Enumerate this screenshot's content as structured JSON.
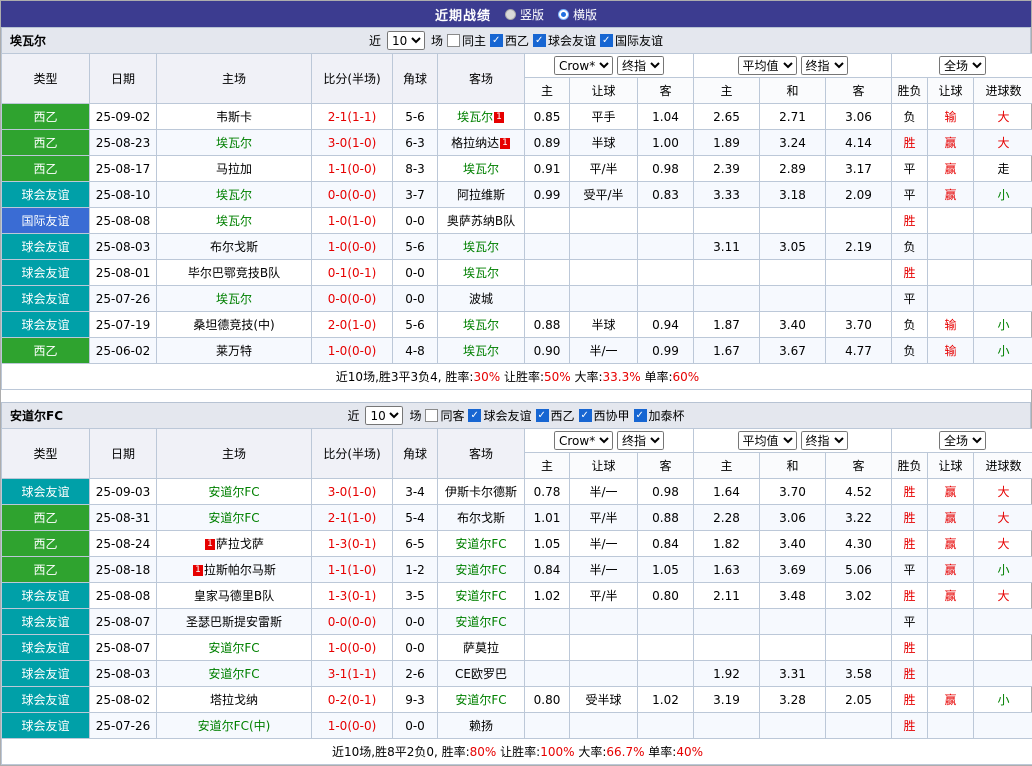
{
  "topbar": {
    "title": "近期战绩",
    "radios": [
      {
        "label": "竖版",
        "selected": false
      },
      {
        "label": "横版",
        "selected": true
      }
    ]
  },
  "colors": {
    "topbar_bg": "#3c3c90",
    "league_xiyi_green": "#2fa32f",
    "club_friendly_teal": "#00a0a8",
    "intl_friendly_blue": "#3a6cd4",
    "score_red": "#e60000",
    "focus_team_green": "#008000",
    "checkbox_blue": "#1766d2"
  },
  "table_header": {
    "main_cols": [
      "类型",
      "日期",
      "主场",
      "比分(半场)",
      "角球",
      "客场"
    ],
    "group1": {
      "select_a": "Crow*",
      "select_b": "终指",
      "subs": [
        "主",
        "让球",
        "客"
      ]
    },
    "group2": {
      "select_a": "平均值",
      "select_b": "终指",
      "subs": [
        "主",
        "和",
        "客"
      ]
    },
    "group3": {
      "select_a": "全场",
      "subs": [
        "胜负",
        "让球",
        "进球数"
      ]
    }
  },
  "sections": [
    {
      "team": "埃瓦尔",
      "filter": {
        "prefix": "近",
        "count": "10",
        "suffix": "场",
        "same": {
          "label": "同主",
          "checked": false
        },
        "leagues": [
          {
            "label": "西乙",
            "checked": true
          },
          {
            "label": "球会友谊",
            "checked": true
          },
          {
            "label": "国际友谊",
            "checked": true
          }
        ]
      },
      "rows": [
        {
          "type": "西乙",
          "date": "25-09-02",
          "home": "韦斯卡",
          "home_green": false,
          "home_card": "",
          "home_card_pos": "",
          "score": "2-1(1-1)",
          "corner": "5-6",
          "away": "埃瓦尔",
          "away_green": true,
          "away_card": "1",
          "away_card_pos": "after",
          "o1": [
            "0.85",
            "平手",
            "1.04"
          ],
          "o2": [
            "2.65",
            "2.71",
            "3.06"
          ],
          "res": [
            "负",
            "输",
            "大"
          ]
        },
        {
          "type": "西乙",
          "date": "25-08-23",
          "home": "埃瓦尔",
          "home_green": true,
          "home_card": "",
          "home_card_pos": "",
          "score": "3-0(1-0)",
          "corner": "6-3",
          "away": "格拉纳达",
          "away_green": false,
          "away_card": "1",
          "away_card_pos": "after",
          "o1": [
            "0.89",
            "半球",
            "1.00"
          ],
          "o2": [
            "1.89",
            "3.24",
            "4.14"
          ],
          "res": [
            "胜",
            "赢",
            "大"
          ]
        },
        {
          "type": "西乙",
          "date": "25-08-17",
          "home": "马拉加",
          "home_green": false,
          "home_card": "",
          "home_card_pos": "",
          "score": "1-1(0-0)",
          "corner": "8-3",
          "away": "埃瓦尔",
          "away_green": true,
          "away_card": "",
          "away_card_pos": "",
          "o1": [
            "0.91",
            "平/半",
            "0.98"
          ],
          "o2": [
            "2.39",
            "2.89",
            "3.17"
          ],
          "res": [
            "平",
            "赢",
            "走"
          ]
        },
        {
          "type": "球会友谊",
          "date": "25-08-10",
          "home": "埃瓦尔",
          "home_green": true,
          "home_card": "",
          "home_card_pos": "",
          "score": "0-0(0-0)",
          "corner": "3-7",
          "away": "阿拉维斯",
          "away_green": false,
          "away_card": "",
          "away_card_pos": "",
          "o1": [
            "0.99",
            "受平/半",
            "0.83"
          ],
          "o2": [
            "3.33",
            "3.18",
            "2.09"
          ],
          "res": [
            "平",
            "赢",
            "小"
          ]
        },
        {
          "type": "国际友谊",
          "date": "25-08-08",
          "home": "埃瓦尔",
          "home_green": true,
          "home_card": "",
          "home_card_pos": "",
          "score": "1-0(1-0)",
          "corner": "0-0",
          "away": "奥萨苏纳B队",
          "away_green": false,
          "away_card": "",
          "away_card_pos": "",
          "o1": [
            "",
            "",
            ""
          ],
          "o2": [
            "",
            "",
            ""
          ],
          "res": [
            "胜",
            "",
            ""
          ]
        },
        {
          "type": "球会友谊",
          "date": "25-08-03",
          "home": "布尔戈斯",
          "home_green": false,
          "home_card": "",
          "home_card_pos": "",
          "score": "1-0(0-0)",
          "corner": "5-6",
          "away": "埃瓦尔",
          "away_green": true,
          "away_card": "",
          "away_card_pos": "",
          "o1": [
            "",
            "",
            ""
          ],
          "o2": [
            "3.11",
            "3.05",
            "2.19"
          ],
          "res": [
            "负",
            "",
            ""
          ]
        },
        {
          "type": "球会友谊",
          "date": "25-08-01",
          "home": "毕尔巴鄂竞技B队",
          "home_green": false,
          "home_card": "",
          "home_card_pos": "",
          "score": "0-1(0-1)",
          "corner": "0-0",
          "away": "埃瓦尔",
          "away_green": true,
          "away_card": "",
          "away_card_pos": "",
          "o1": [
            "",
            "",
            ""
          ],
          "o2": [
            "",
            "",
            ""
          ],
          "res": [
            "胜",
            "",
            ""
          ]
        },
        {
          "type": "球会友谊",
          "date": "25-07-26",
          "home": "埃瓦尔",
          "home_green": true,
          "home_card": "",
          "home_card_pos": "",
          "score": "0-0(0-0)",
          "corner": "0-0",
          "away": "波城",
          "away_green": false,
          "away_card": "",
          "away_card_pos": "",
          "o1": [
            "",
            "",
            ""
          ],
          "o2": [
            "",
            "",
            ""
          ],
          "res": [
            "平",
            "",
            ""
          ]
        },
        {
          "type": "球会友谊",
          "date": "25-07-19",
          "home": "桑坦德竞技(中)",
          "home_green": false,
          "home_card": "",
          "home_card_pos": "",
          "score": "2-0(1-0)",
          "corner": "5-6",
          "away": "埃瓦尔",
          "away_green": true,
          "away_card": "",
          "away_card_pos": "",
          "o1": [
            "0.88",
            "半球",
            "0.94"
          ],
          "o2": [
            "1.87",
            "3.40",
            "3.70"
          ],
          "res": [
            "负",
            "输",
            "小"
          ]
        },
        {
          "type": "西乙",
          "date": "25-06-02",
          "home": "莱万特",
          "home_green": false,
          "home_card": "",
          "home_card_pos": "",
          "score": "1-0(0-0)",
          "corner": "4-8",
          "away": "埃瓦尔",
          "away_green": true,
          "away_card": "",
          "away_card_pos": "",
          "o1": [
            "0.90",
            "半/一",
            "0.99"
          ],
          "o2": [
            "1.67",
            "3.67",
            "4.77"
          ],
          "res": [
            "负",
            "输",
            "小"
          ]
        }
      ],
      "summary": [
        {
          "t": "近10场,胜3平3负4, 胜率:",
          "red": false
        },
        {
          "t": "30%",
          "red": true
        },
        {
          "t": " 让胜率:",
          "red": false
        },
        {
          "t": "50%",
          "red": true
        },
        {
          "t": " 大率:",
          "red": false
        },
        {
          "t": "33.3%",
          "red": true
        },
        {
          "t": " 单率:",
          "red": false
        },
        {
          "t": "60%",
          "red": true
        }
      ]
    },
    {
      "team": "安道尔FC",
      "filter": {
        "prefix": "近",
        "count": "10",
        "suffix": "场",
        "same": {
          "label": "同客",
          "checked": false
        },
        "leagues": [
          {
            "label": "球会友谊",
            "checked": true
          },
          {
            "label": "西乙",
            "checked": true
          },
          {
            "label": "西协甲",
            "checked": true
          },
          {
            "label": "加泰杯",
            "checked": true
          }
        ]
      },
      "rows": [
        {
          "type": "球会友谊",
          "date": "25-09-03",
          "home": "安道尔FC",
          "home_green": true,
          "home_card": "",
          "home_card_pos": "",
          "score": "3-0(1-0)",
          "corner": "3-4",
          "away": "伊斯卡尔德斯",
          "away_green": false,
          "away_card": "",
          "away_card_pos": "",
          "o1": [
            "0.78",
            "半/一",
            "0.98"
          ],
          "o2": [
            "1.64",
            "3.70",
            "4.52"
          ],
          "res": [
            "胜",
            "赢",
            "大"
          ]
        },
        {
          "type": "西乙",
          "date": "25-08-31",
          "home": "安道尔FC",
          "home_green": true,
          "home_card": "",
          "home_card_pos": "",
          "score": "2-1(1-0)",
          "corner": "5-4",
          "away": "布尔戈斯",
          "away_green": false,
          "away_card": "",
          "away_card_pos": "",
          "o1": [
            "1.01",
            "平/半",
            "0.88"
          ],
          "o2": [
            "2.28",
            "3.06",
            "3.22"
          ],
          "res": [
            "胜",
            "赢",
            "大"
          ]
        },
        {
          "type": "西乙",
          "date": "25-08-24",
          "home": "萨拉戈萨",
          "home_green": false,
          "home_card": "1",
          "home_card_pos": "before",
          "score": "1-3(0-1)",
          "corner": "6-5",
          "away": "安道尔FC",
          "away_green": true,
          "away_card": "",
          "away_card_pos": "",
          "o1": [
            "1.05",
            "半/一",
            "0.84"
          ],
          "o2": [
            "1.82",
            "3.40",
            "4.30"
          ],
          "res": [
            "胜",
            "赢",
            "大"
          ]
        },
        {
          "type": "西乙",
          "date": "25-08-18",
          "home": "拉斯帕尔马斯",
          "home_green": false,
          "home_card": "1",
          "home_card_pos": "before",
          "score": "1-1(1-0)",
          "corner": "1-2",
          "away": "安道尔FC",
          "away_green": true,
          "away_card": "",
          "away_card_pos": "",
          "o1": [
            "0.84",
            "半/一",
            "1.05"
          ],
          "o2": [
            "1.63",
            "3.69",
            "5.06"
          ],
          "res": [
            "平",
            "赢",
            "小"
          ]
        },
        {
          "type": "球会友谊",
          "date": "25-08-08",
          "home": "皇家马德里B队",
          "home_green": false,
          "home_card": "",
          "home_card_pos": "",
          "score": "1-3(0-1)",
          "corner": "3-5",
          "away": "安道尔FC",
          "away_green": true,
          "away_card": "",
          "away_card_pos": "",
          "o1": [
            "1.02",
            "平/半",
            "0.80"
          ],
          "o2": [
            "2.11",
            "3.48",
            "3.02"
          ],
          "res": [
            "胜",
            "赢",
            "大"
          ]
        },
        {
          "type": "球会友谊",
          "date": "25-08-07",
          "home": "圣瑟巴斯提安雷斯",
          "home_green": false,
          "home_card": "",
          "home_card_pos": "",
          "score": "0-0(0-0)",
          "corner": "0-0",
          "away": "安道尔FC",
          "away_green": true,
          "away_card": "",
          "away_card_pos": "",
          "o1": [
            "",
            "",
            ""
          ],
          "o2": [
            "",
            "",
            ""
          ],
          "res": [
            "平",
            "",
            ""
          ]
        },
        {
          "type": "球会友谊",
          "date": "25-08-07",
          "home": "安道尔FC",
          "home_green": true,
          "home_card": "",
          "home_card_pos": "",
          "score": "1-0(0-0)",
          "corner": "0-0",
          "away": "萨莫拉",
          "away_green": false,
          "away_card": "",
          "away_card_pos": "",
          "o1": [
            "",
            "",
            ""
          ],
          "o2": [
            "",
            "",
            ""
          ],
          "res": [
            "胜",
            "",
            ""
          ]
        },
        {
          "type": "球会友谊",
          "date": "25-08-03",
          "home": "安道尔FC",
          "home_green": true,
          "home_card": "",
          "home_card_pos": "",
          "score": "3-1(1-1)",
          "corner": "2-6",
          "away": "CE欧罗巴",
          "away_green": false,
          "away_card": "",
          "away_card_pos": "",
          "o1": [
            "",
            "",
            ""
          ],
          "o2": [
            "1.92",
            "3.31",
            "3.58"
          ],
          "res": [
            "胜",
            "",
            ""
          ]
        },
        {
          "type": "球会友谊",
          "date": "25-08-02",
          "home": "塔拉戈纳",
          "home_green": false,
          "home_card": "",
          "home_card_pos": "",
          "score": "0-2(0-1)",
          "corner": "9-3",
          "away": "安道尔FC",
          "away_green": true,
          "away_card": "",
          "away_card_pos": "",
          "o1": [
            "0.80",
            "受半球",
            "1.02"
          ],
          "o2": [
            "3.19",
            "3.28",
            "2.05"
          ],
          "res": [
            "胜",
            "赢",
            "小"
          ]
        },
        {
          "type": "球会友谊",
          "date": "25-07-26",
          "home": "安道尔FC(中)",
          "home_green": true,
          "home_card": "",
          "home_card_pos": "",
          "score": "1-0(0-0)",
          "corner": "0-0",
          "away": "赖扬",
          "away_green": false,
          "away_card": "",
          "away_card_pos": "",
          "o1": [
            "",
            "",
            ""
          ],
          "o2": [
            "",
            "",
            ""
          ],
          "res": [
            "胜",
            "",
            ""
          ]
        }
      ],
      "summary": [
        {
          "t": "近10场,胜8平2负0, 胜率:",
          "red": false
        },
        {
          "t": "80%",
          "red": true
        },
        {
          "t": " 让胜率:",
          "red": false
        },
        {
          "t": "100%",
          "red": true
        },
        {
          "t": " 大率:",
          "red": false
        },
        {
          "t": "66.7%",
          "red": true
        },
        {
          "t": " 单率:",
          "red": false
        },
        {
          "t": "40%",
          "red": true
        }
      ]
    }
  ]
}
